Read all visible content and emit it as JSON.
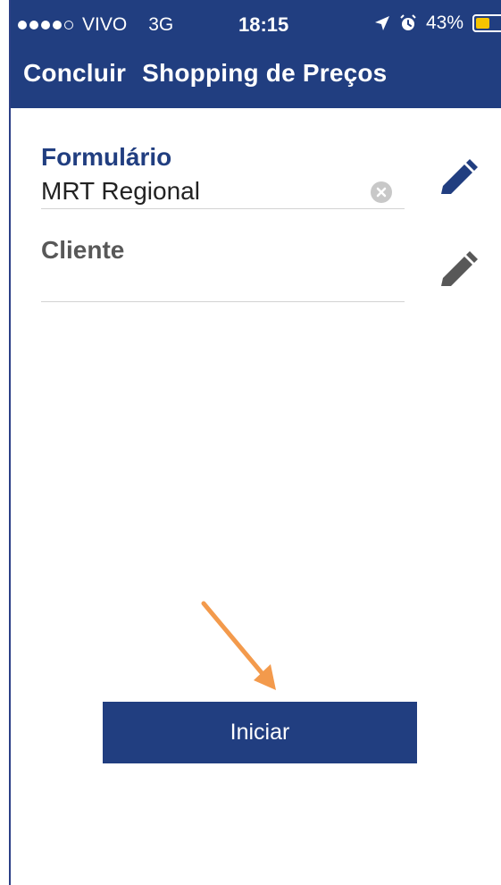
{
  "status_bar": {
    "carrier": "VIVO",
    "network": "3G",
    "time": "18:15",
    "battery_percent": "43%",
    "battery_level": 0.43,
    "battery_color": "#f5c400"
  },
  "header": {
    "title_part1": "Concluir",
    "title_part2": "Shopping de Preços",
    "background": "#213e80"
  },
  "form": {
    "label": "Formulário",
    "value": "MRT Regional"
  },
  "client": {
    "label": "Cliente",
    "value": ""
  },
  "actions": {
    "start_label": "Iniciar"
  },
  "colors": {
    "primary": "#213e80",
    "annotation_arrow": "#f39a4c",
    "secondary_icon": "#585858"
  }
}
